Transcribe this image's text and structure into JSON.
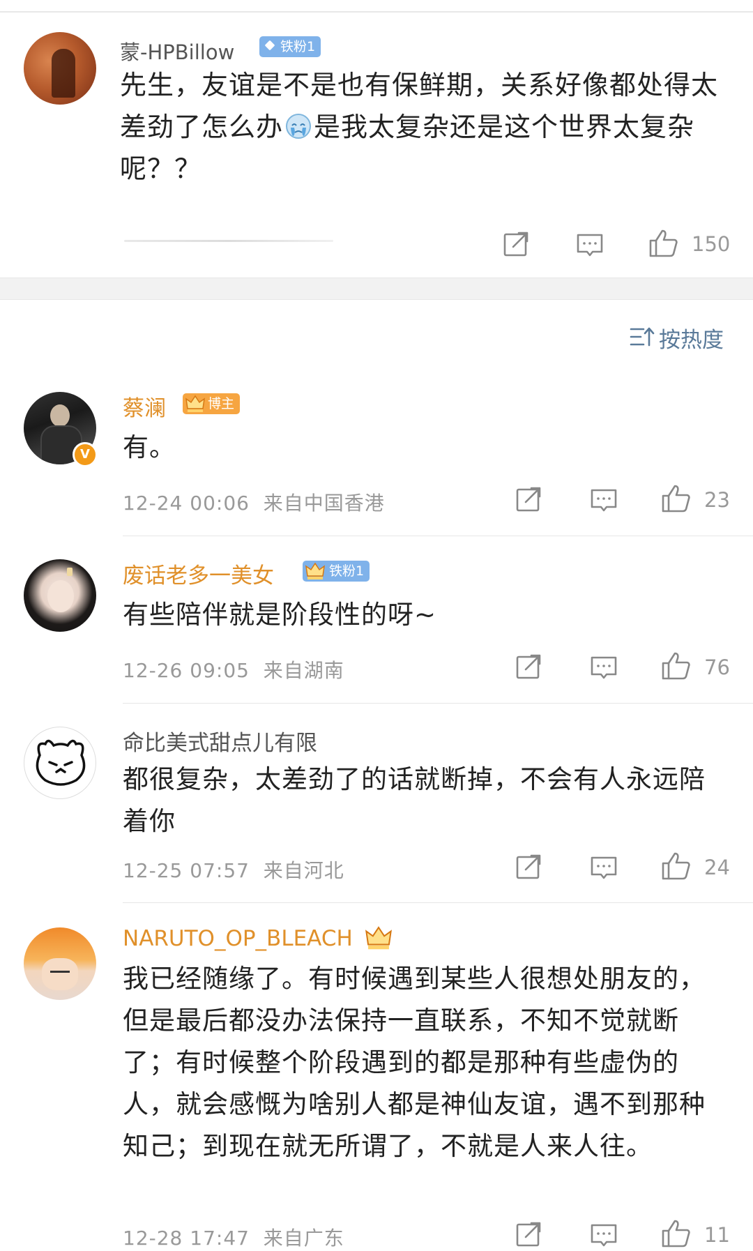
{
  "post": {
    "username": "蒙-HPBillow",
    "badge": "铁粉1",
    "text": "先生，友谊是不是也有保鲜期，关系好像都处得太差劲了怎么办",
    "text_after_emoji": "是我太复杂还是这个世界太复杂呢？？",
    "likes": "150",
    "icons": [
      "share-icon",
      "comment-icon",
      "like-icon"
    ]
  },
  "sort": {
    "label": "按热度"
  },
  "comments": [
    {
      "username": "蔡澜",
      "badge": "博主",
      "verified_mark": "V",
      "text": "有。",
      "time": "12-24 00:06",
      "location": "来自中国香港",
      "likes": "23"
    },
    {
      "username": "废话老多一美女",
      "badge": "铁粉1",
      "text": "有些陪伴就是阶段性的呀~",
      "time": "12-26 09:05",
      "location": "来自湖南",
      "likes": "76"
    },
    {
      "username": "命比美式甜点儿有限",
      "text": "都很复杂，太差劲了的话就断掉，不会有人永远陪着你",
      "time": "12-25 07:57",
      "location": "来自河北",
      "likes": "24"
    },
    {
      "username": "NARUTO_OP_BLEACH",
      "text": "我已经随缘了。有时候遇到某些人很想处朋友的，但是最后都没办法保持一直联系，不知不觉就断了；有时候整个阶段遇到的都是那种有些虚伪的人，就会感慨为啥别人都是神仙友谊，遇不到那种知己；到现在就无所谓了，不就是人来人往。",
      "time": "12-28 17:47",
      "location": "来自广东",
      "likes": "11"
    }
  ],
  "colors": {
    "orange_name": "#e0902a",
    "grey_name": "#555555",
    "meta": "#999999",
    "sort_blue": "#5a7a99",
    "badge_blue": "#7fb2ea",
    "badge_orange": "#f6a541"
  }
}
